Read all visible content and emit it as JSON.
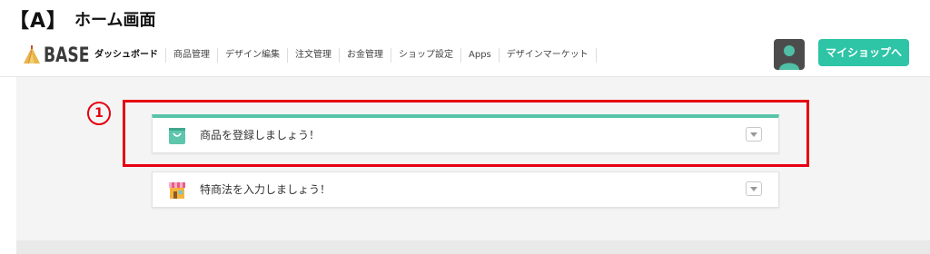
{
  "caption": {
    "bracket": "【A】",
    "title": "ホーム画面"
  },
  "header": {
    "logo_text": "BASE",
    "nav": [
      "ダッシュボード",
      "商品管理",
      "デザイン編集",
      "注文管理",
      "お金管理",
      "ショップ設定",
      "Apps",
      "デザインマーケット"
    ],
    "shop_button": "マイショップへ"
  },
  "annotation": {
    "marker": "1"
  },
  "cards": [
    {
      "label": "商品を登録しましょう！",
      "icon": "shopping-bag-icon",
      "accent": "#57c4a9"
    },
    {
      "label": "特商法を入力しましょう！",
      "icon": "store-icon"
    }
  ],
  "colors": {
    "brand": "#2ec4a6",
    "highlight": "#e60012"
  }
}
